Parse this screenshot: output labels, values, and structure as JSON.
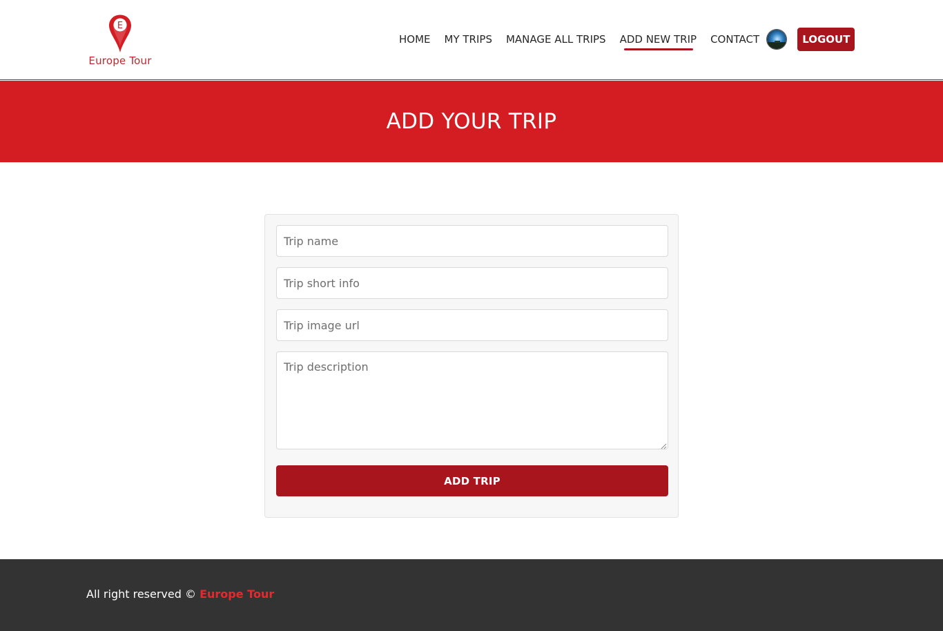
{
  "header": {
    "logo_letter": "E",
    "logo_text": "Europe Tour",
    "nav": {
      "home": "HOME",
      "my_trips": "MY TRIPS",
      "manage_all_trips": "MANAGE ALL TRIPS",
      "add_new_trip": "ADD NEW TRIP",
      "contact": "CONTACT"
    },
    "active_nav": "ADD NEW TRIP",
    "logout_label": "LOGOUT"
  },
  "banner": {
    "title": "ADD YOUR TRIP"
  },
  "form": {
    "trip_name_placeholder": "Trip name",
    "trip_short_info_placeholder": "Trip short info",
    "trip_image_url_placeholder": "Trip image url",
    "trip_description_placeholder": "Trip description",
    "submit_label": "ADD TRIP"
  },
  "footer": {
    "text": "All right reserved ©",
    "brand": "Europe Tour"
  },
  "colors": {
    "brand_red": "#d31d22",
    "button_red": "#a8151c",
    "footer_bg": "#333333",
    "footer_brand": "#e52a2f"
  },
  "icons": {
    "logo": "map-pin-icon",
    "avatar": "user-avatar-icon"
  }
}
